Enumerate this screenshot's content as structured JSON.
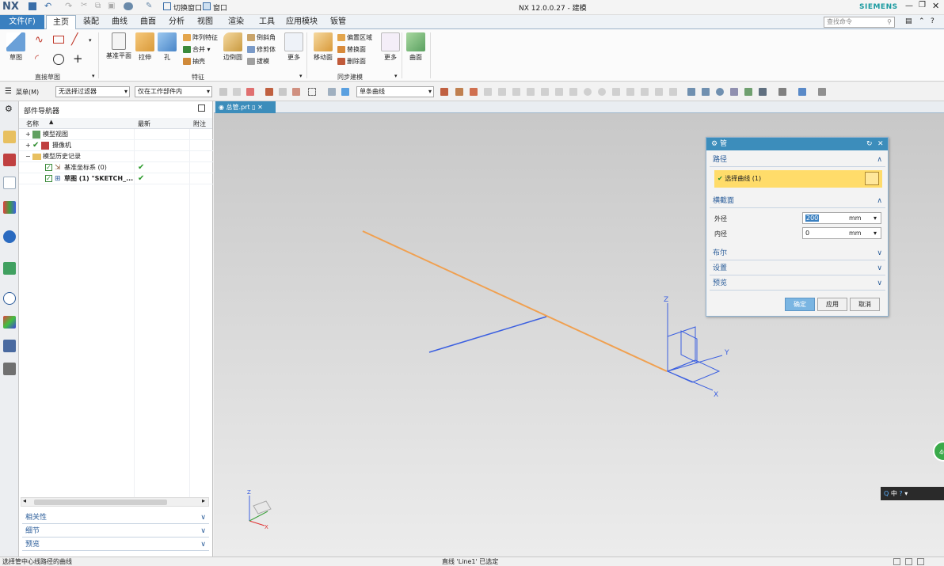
{
  "app": {
    "logo": "NX",
    "title": "NX 12.0.0.27 - 建模",
    "brand": "SIEMENS",
    "switch_window": "切换窗口",
    "window_menu": "窗口",
    "search_placeholder": "查找命令",
    "accent": "#3a80c0"
  },
  "tabs": [
    {
      "label": "文件(F)"
    },
    {
      "label": "主页"
    },
    {
      "label": "装配"
    },
    {
      "label": "曲线"
    },
    {
      "label": "曲面"
    },
    {
      "label": "分析"
    },
    {
      "label": "视图"
    },
    {
      "label": "渲染"
    },
    {
      "label": "工具"
    },
    {
      "label": "应用模块"
    },
    {
      "label": "钣管"
    }
  ],
  "ribbon": {
    "sketch": "草图",
    "group_direct_sketch": "直接草图",
    "datum_plane": "基准平面",
    "extrude": "拉伸",
    "hole": "孔",
    "pattern_feature": "阵列特征",
    "unite": "合并",
    "shell": "抽壳",
    "edge_blend": "边倒圆",
    "chamfer": "倒斜角",
    "trim_body": "修剪体",
    "draft": "拔模",
    "more": "更多",
    "group_feature": "特征",
    "move_face": "移动面",
    "offset_region": "偏置区域",
    "replace_face": "替换面",
    "delete_face": "删除面",
    "more2": "更多",
    "group_sync": "同步建模",
    "surface": "曲面"
  },
  "selbar": {
    "menu": "菜单(M)",
    "filter": "无选择过滤器",
    "scope": "仅在工作部件内",
    "curve_rule": "单条曲线"
  },
  "navigator": {
    "title": "部件导航器",
    "col_name": "名称",
    "col_latest": "最新",
    "col_note": "附注",
    "rows": [
      {
        "label": "模型视图"
      },
      {
        "label": "摄像机"
      },
      {
        "label": "模型历史记录"
      },
      {
        "label": "基准坐标系 (0)"
      },
      {
        "label": "草图 (1) \"SKETCH_..."
      }
    ],
    "accordions": [
      {
        "label": "相关性"
      },
      {
        "label": "细节"
      },
      {
        "label": "预览"
      }
    ]
  },
  "viewport": {
    "tab_label": "总管.prt",
    "axis_z": "Z",
    "axis_y": "Y",
    "axis_x": "X",
    "curve_orange": "#f0a050",
    "curve_blue": "#3b5fe0",
    "lang": "中"
  },
  "dialog": {
    "title": "管",
    "sec_path": "路径",
    "select_curve": "选择曲线 (1)",
    "sec_section": "横截面",
    "outer_label": "外径",
    "outer_value": "200",
    "outer_unit": "mm",
    "inner_label": "内径",
    "inner_value": "0",
    "inner_unit": "mm",
    "sec_boolean": "布尔",
    "sec_settings": "设置",
    "sec_preview": "预览",
    "ok": "确定",
    "apply": "应用",
    "cancel": "取消"
  },
  "status": {
    "left": "选择管中心线路径的曲线",
    "center": "直线 'Line1' 已选定"
  },
  "badge": "40"
}
